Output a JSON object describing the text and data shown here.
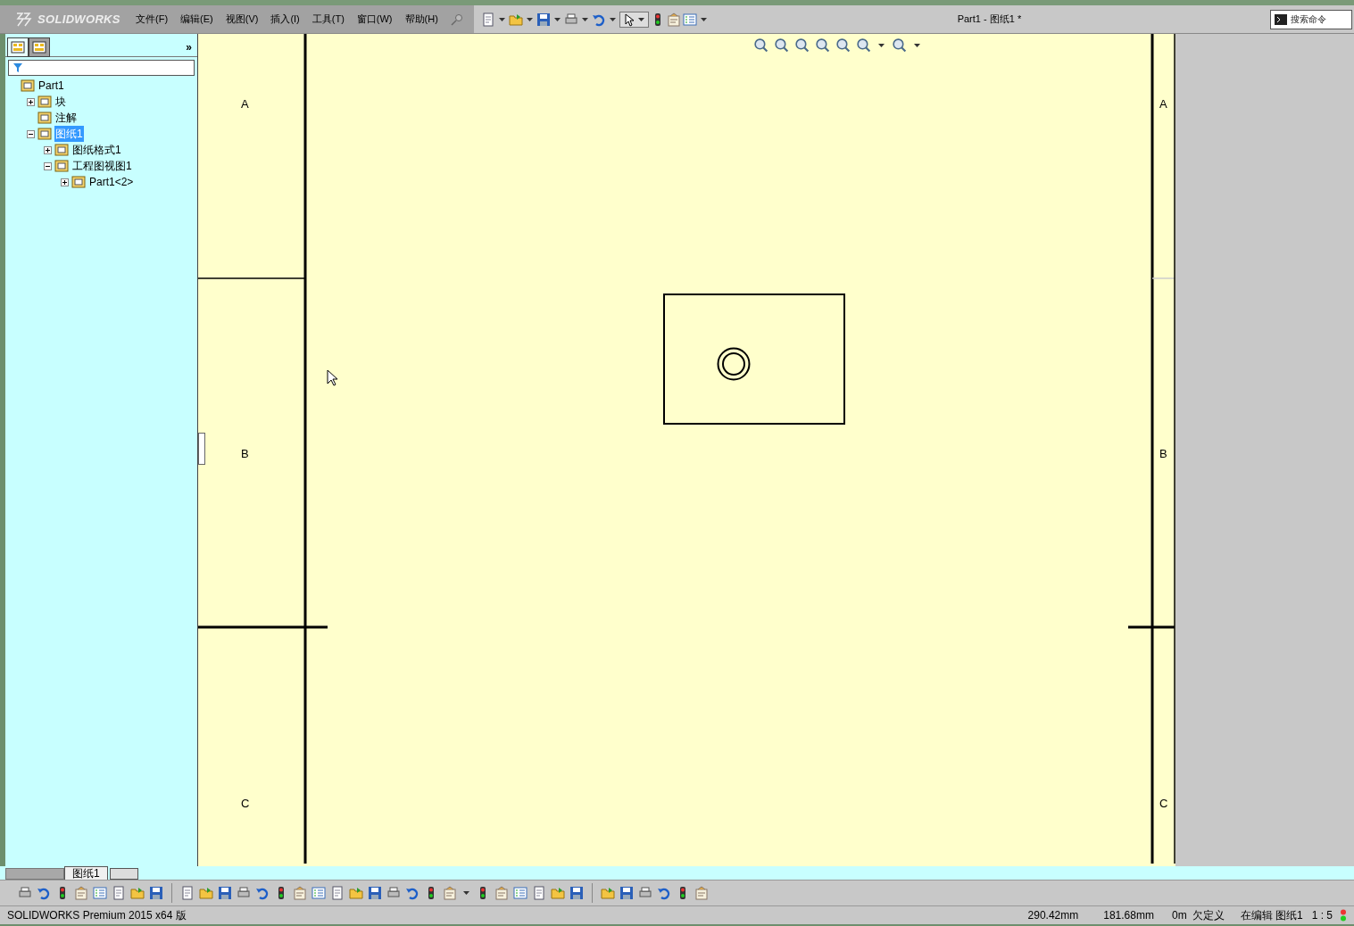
{
  "app": {
    "logo": "SOLIDWORKS"
  },
  "menu": [
    {
      "label": "文件(F)"
    },
    {
      "label": "编辑(E)"
    },
    {
      "label": "视图(V)"
    },
    {
      "label": "插入(I)"
    },
    {
      "label": "工具(T)"
    },
    {
      "label": "窗口(W)"
    },
    {
      "label": "帮助(H)"
    }
  ],
  "window": {
    "title": "Part1 - 图纸1 *"
  },
  "search": {
    "placeholder": "搜索命令"
  },
  "sidebar": {
    "more": "»",
    "tabs": [
      {
        "selected": true
      },
      {
        "selected": false
      }
    ],
    "tree": [
      {
        "label": "Part1",
        "selected": false,
        "children": [
          {
            "label": "块",
            "selected": false,
            "expanded": false
          },
          {
            "label": "注解",
            "selected": false
          },
          {
            "label": "图纸1",
            "selected": true,
            "expanded": true,
            "children": [
              {
                "label": "图纸格式1",
                "selected": false,
                "expanded": false
              },
              {
                "label": "工程图视图1",
                "selected": false,
                "expanded": true,
                "children": [
                  {
                    "label": "Part1<2>",
                    "selected": false,
                    "expanded": false
                  }
                ]
              }
            ]
          }
        ]
      }
    ]
  },
  "sheet": {
    "zones_left": [
      "A",
      "B",
      "C"
    ],
    "zones_right": [
      "A",
      "B",
      "C"
    ]
  },
  "sheet_tabs": [
    {
      "label": "图纸1",
      "selected": true
    }
  ],
  "status_bar": {
    "product": "SOLIDWORKS Premium 2015 x64 版",
    "x": "290.42mm",
    "y": "181.68mm",
    "z": "0m",
    "state": "欠定义",
    "mode": "在编辑 图纸1",
    "scale": "1 : 5"
  }
}
